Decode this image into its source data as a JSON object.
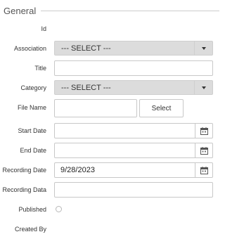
{
  "section": {
    "title": "General"
  },
  "fields": {
    "id": {
      "label": "Id"
    },
    "association": {
      "label": "Association",
      "selected": "--- SELECT ---"
    },
    "title": {
      "label": "Title",
      "value": ""
    },
    "category": {
      "label": "Category",
      "selected": "--- SELECT ---"
    },
    "file_name": {
      "label": "File Name",
      "value": "",
      "button_label": "Select"
    },
    "start_date": {
      "label": "Start Date",
      "value": ""
    },
    "end_date": {
      "label": "End Date",
      "value": ""
    },
    "recording_date": {
      "label": "Recording Date",
      "value": "9/28/2023"
    },
    "recording_data": {
      "label": "Recording Data",
      "value": ""
    },
    "published": {
      "label": "Published",
      "checked": false
    },
    "created_by": {
      "label": "Created By"
    }
  },
  "icons": {
    "dropdown": "chevron-down-icon",
    "calendar": "calendar-icon"
  },
  "colors": {
    "select_bg": "#dcdcdc",
    "border": "#c8c8c8",
    "legend_line": "#cccccc"
  }
}
